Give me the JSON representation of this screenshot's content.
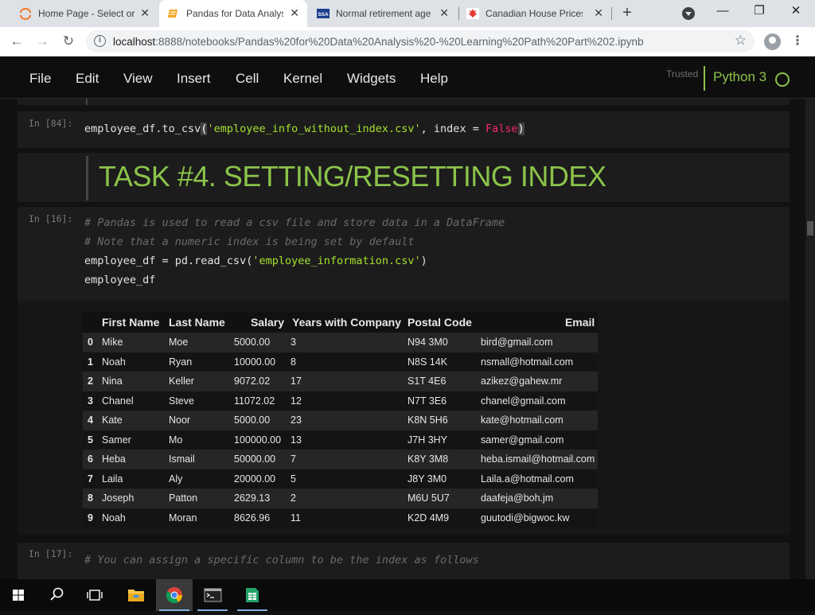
{
  "browser": {
    "tabs": [
      {
        "title": "Home Page - Select or create a notebook",
        "icon": "jupyter-icon",
        "active": false
      },
      {
        "title": "Pandas for Data Analysis",
        "icon": "notebook-icon",
        "active": true
      },
      {
        "title": "Normal retirement age",
        "icon": "ssa-icon",
        "active": false
      },
      {
        "title": "Canadian House Prices",
        "icon": "maple-leaf-icon",
        "active": false
      }
    ],
    "new_tab_label": "+",
    "window_controls": {
      "minimize": "—",
      "restore": "❐",
      "close": "✕"
    },
    "url_host": "localhost",
    "url_path": ":8888/notebooks/Pandas%20for%20Data%20Analysis%20-%20Learning%20Path%20Part%202.ipynb"
  },
  "jupyter": {
    "menu": [
      "File",
      "Edit",
      "View",
      "Insert",
      "Cell",
      "Kernel",
      "Widgets",
      "Help"
    ],
    "trusted_label": "Trusted",
    "kernel_name": "Python 3"
  },
  "cells": {
    "c84": {
      "prompt": "In [84]:",
      "code_prefix": "employee_df.to_csv",
      "code_string": "'employee_info_without_index.csv'",
      "code_mid": ", index = ",
      "code_kw": "False"
    },
    "markdown": {
      "text": "TASK #4. SETTING/RESETTING INDEX"
    },
    "c16": {
      "prompt": "In [16]:",
      "comment1": "# Pandas is used to read a csv file and store data in a DataFrame",
      "comment2": "# Note that a numeric index is being set by default",
      "line3_prefix": "employee_df = pd.read_csv(",
      "line3_string": "'employee_information.csv'",
      "line3_suffix": ")",
      "line4": "employee_df"
    },
    "c17": {
      "prompt": "In [17]:",
      "comment": "# You can assign a specific column to be the index as follows"
    }
  },
  "dataframe": {
    "columns": [
      "First Name",
      "Last Name",
      "Salary",
      "Years with Company",
      "Postal Code",
      "Email"
    ],
    "rows": [
      [
        "0",
        "Mike",
        "Moe",
        "5000.00",
        "3",
        "N94 3M0",
        "bird@gmail.com"
      ],
      [
        "1",
        "Noah",
        "Ryan",
        "10000.00",
        "8",
        "N8S 14K",
        "nsmall@hotmail.com"
      ],
      [
        "2",
        "Nina",
        "Keller",
        "9072.02",
        "17",
        "S1T 4E6",
        "azikez@gahew.mr"
      ],
      [
        "3",
        "Chanel",
        "Steve",
        "11072.02",
        "12",
        "N7T 3E6",
        "chanel@gmail.com"
      ],
      [
        "4",
        "Kate",
        "Noor",
        "5000.00",
        "23",
        "K8N 5H6",
        "kate@hotmail.com"
      ],
      [
        "5",
        "Samer",
        "Mo",
        "100000.00",
        "13",
        "J7H 3HY",
        "samer@gmail.com"
      ],
      [
        "6",
        "Heba",
        "Ismail",
        "50000.00",
        "7",
        "K8Y 3M8",
        "heba.ismail@hotmail.com"
      ],
      [
        "7",
        "Laila",
        "Aly",
        "20000.00",
        "5",
        "J8Y 3M0",
        "Laila.a@hotmail.com"
      ],
      [
        "8",
        "Joseph",
        "Patton",
        "2629.13",
        "2",
        "M6U 5U7",
        "daafeja@boh.jm"
      ],
      [
        "9",
        "Noah",
        "Moran",
        "8626.96",
        "11",
        "K2D 4M9",
        "guutodi@bigwoc.kw"
      ]
    ]
  },
  "taskbar": {
    "items": [
      "windows-start-icon",
      "search-icon",
      "task-view-icon",
      "file-explorer-icon",
      "chrome-icon",
      "terminal-icon",
      "spreadsheet-icon"
    ]
  },
  "colors": {
    "accent_green": "#8bc34a",
    "string_green": "#a6e22e",
    "keyword_pink": "#f92672"
  }
}
